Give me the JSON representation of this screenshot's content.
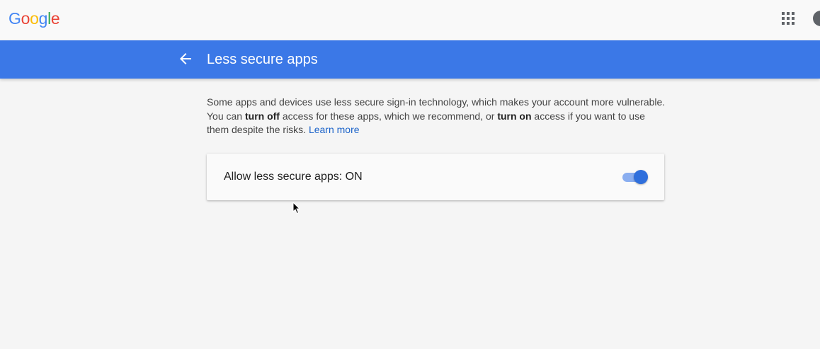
{
  "topbar": {
    "logo_letters": [
      {
        "char": "G",
        "color": "#4285F4"
      },
      {
        "char": "o",
        "color": "#EA4335"
      },
      {
        "char": "o",
        "color": "#FBBC05"
      },
      {
        "char": "g",
        "color": "#4285F4"
      },
      {
        "char": "l",
        "color": "#34A853"
      },
      {
        "char": "e",
        "color": "#EA4335"
      }
    ],
    "apps_icon": "grid-apps-icon",
    "avatar_icon": "account-avatar-icon"
  },
  "header": {
    "back_icon": "arrow-back-icon",
    "title": "Less secure apps",
    "background_color": "#3b78e7"
  },
  "description": {
    "part1": "Some apps and devices use less secure sign-in technology, which makes your account more vulnerable. You can ",
    "bold1": "turn off",
    "part2": " access for these apps, which we recommend, or ",
    "bold2": "turn on",
    "part3": " access if you want to use them despite the risks. ",
    "link": "Learn more"
  },
  "setting": {
    "label": "Allow less secure apps: ON",
    "toggle_on": true,
    "toggle_color": "#2f6fdc"
  }
}
